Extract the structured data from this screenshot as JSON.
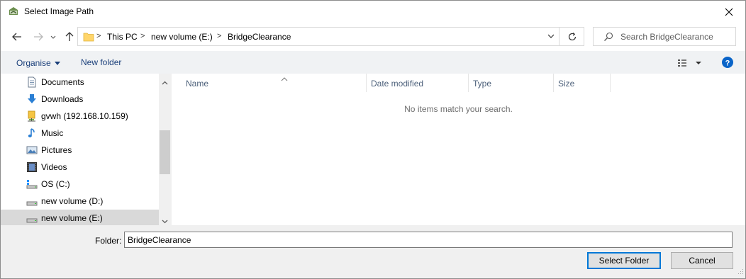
{
  "window": {
    "title": "Select Image Path"
  },
  "address": {
    "crumbs": [
      "This PC",
      "new volume (E:)",
      "BridgeClearance"
    ]
  },
  "search": {
    "placeholder": "Search BridgeClearance"
  },
  "toolbar": {
    "organise_label": "Organise",
    "new_folder_label": "New folder"
  },
  "nav_pane": {
    "items": [
      {
        "label": "Documents",
        "icon": "documents-icon"
      },
      {
        "label": "Downloads",
        "icon": "downloads-icon"
      },
      {
        "label": "gvwh (192.168.10.159)",
        "icon": "network-drive-icon"
      },
      {
        "label": "Music",
        "icon": "music-icon"
      },
      {
        "label": "Pictures",
        "icon": "pictures-icon"
      },
      {
        "label": "Videos",
        "icon": "videos-icon"
      },
      {
        "label": "OS (C:)",
        "icon": "os-drive-icon"
      },
      {
        "label": "new volume (D:)",
        "icon": "drive-icon"
      },
      {
        "label": "new volume (E:)",
        "icon": "drive-icon",
        "selected": true
      }
    ]
  },
  "file_list": {
    "columns": [
      "Name",
      "Date modified",
      "Type",
      "Size"
    ],
    "empty_message": "No items match your search."
  },
  "footer": {
    "folder_label": "Folder:",
    "folder_value": "BridgeClearance",
    "select_label": "Select Folder",
    "cancel_label": "Cancel"
  },
  "colors": {
    "accent": "#0078d7",
    "selected_bg": "#d9d9d9",
    "link_text": "#1a3f7a"
  }
}
